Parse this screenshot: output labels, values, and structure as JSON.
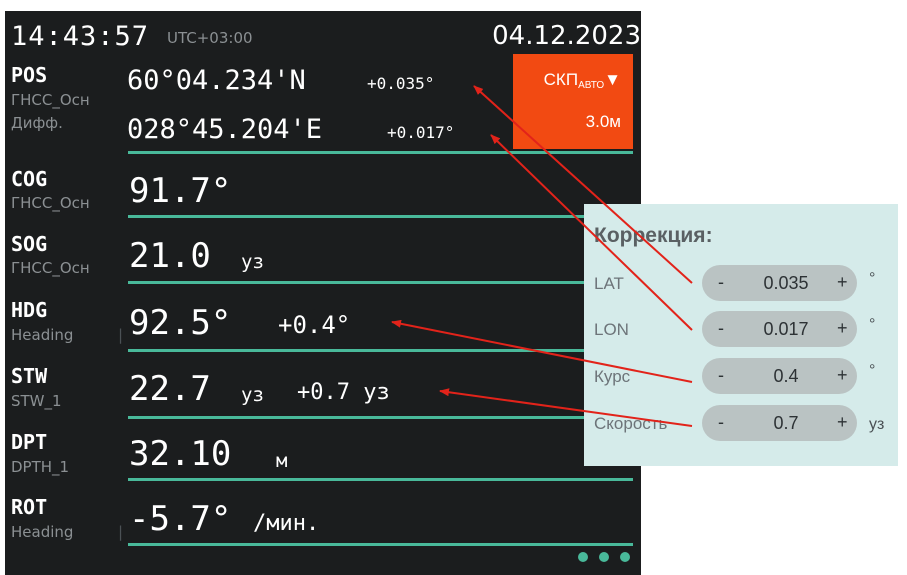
{
  "header": {
    "time": "14:43:57",
    "timezone": "UTC+03:00",
    "date": "04.12.2023"
  },
  "pos": {
    "label": "POS",
    "source": "ГНСС_Осн",
    "mode": "Дифф.",
    "lat": "60°04.234'N",
    "lat_corr": "+0.035°",
    "lon": "028°45.204'E",
    "lon_corr": "+0.017°"
  },
  "skp": {
    "label": "СКП",
    "sub": "АВТО",
    "arrow": "▼",
    "value": "3.0м",
    "color": "#f24a12"
  },
  "rows": {
    "cog": {
      "label": "COG",
      "source": "ГНСС_Осн",
      "value": "91.7°"
    },
    "sog": {
      "label": "SOG",
      "source": "ГНСС_Осн",
      "value": "21.0",
      "unit": "уз"
    },
    "hdg": {
      "label": "HDG",
      "source": "Heading",
      "value": "92.5°",
      "corr": "+0.4°"
    },
    "stw": {
      "label": "STW",
      "source": "STW_1",
      "value": "22.7",
      "unit": "уз",
      "corr": "+0.7 уз"
    },
    "dpt": {
      "label": "DPT",
      "source": "DPTH_1",
      "value": "32.10",
      "unit": "м"
    },
    "rot": {
      "label": "ROT",
      "source": "Heading",
      "value": "-5.7°",
      "unit": "/мин."
    }
  },
  "correction": {
    "title": "Коррекция:",
    "minus": "-",
    "plus": "+",
    "items": [
      {
        "label": "LAT",
        "value": "0.035",
        "unit": "°"
      },
      {
        "label": "LON",
        "value": "0.017",
        "unit": "°"
      },
      {
        "label": "Курс",
        "value": "0.4",
        "unit": "°"
      },
      {
        "label": "Скорость",
        "value": "0.7",
        "unit": "уз"
      }
    ]
  },
  "colors": {
    "background": "#1b1d1e",
    "accent": "#49b99a",
    "arrow": "#e2231a",
    "panel": "#d5ebea"
  },
  "icons": {
    "more": "more-dots-icon"
  }
}
